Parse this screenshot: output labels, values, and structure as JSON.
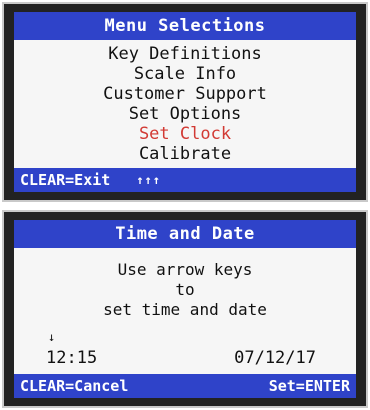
{
  "menu_screen": {
    "title": "Menu Selections",
    "items": [
      {
        "label": "Key Definitions"
      },
      {
        "label": "Scale Info"
      },
      {
        "label": "Customer Support"
      },
      {
        "label": "Set Options"
      },
      {
        "label": "Set Clock",
        "selected": true
      },
      {
        "label": "Calibrate"
      }
    ],
    "footer_left": "CLEAR=Exit",
    "footer_arrows": "↑↑↑",
    "colors": {
      "bar": "#2f43c9",
      "selected_text": "#d23a34"
    }
  },
  "time_screen": {
    "title": "Time and Date",
    "lines": [
      "Use arrow keys",
      "to",
      "set time and date"
    ],
    "cursor": "↓",
    "time": "12:15",
    "date": "07/12/17",
    "footer_left": "CLEAR=Cancel",
    "footer_right": "Set=ENTER"
  }
}
